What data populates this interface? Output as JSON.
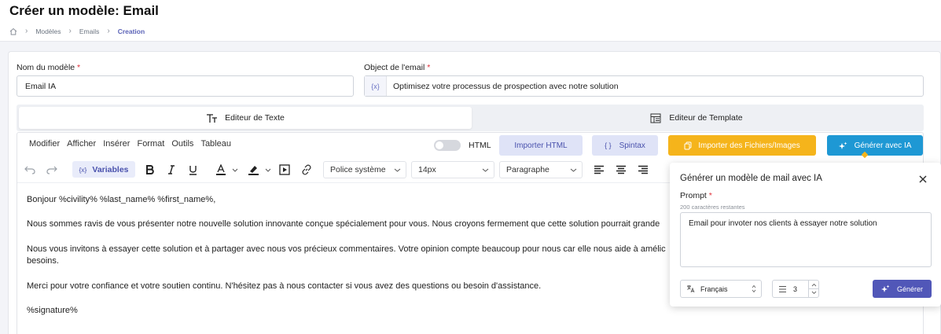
{
  "page": {
    "title": "Créer un modèle: Email",
    "breadcrumb": [
      "Modèles",
      "Emails",
      "Creation"
    ]
  },
  "form": {
    "name_label": "Nom du modèle",
    "name_required": "*",
    "name_value": "Email IA",
    "object_label": "Object de l'email",
    "object_required": "*",
    "object_prefix": "{x}",
    "object_value": "Optimisez votre processus de prospection avec notre solution"
  },
  "tabs": [
    {
      "label": "Editeur de Texte",
      "active": true
    },
    {
      "label": "Editeur de Template",
      "active": false
    }
  ],
  "editor": {
    "menu": [
      "Modifier",
      "Afficher",
      "Insérer",
      "Format",
      "Outils",
      "Tableau"
    ],
    "html_toggle_label": "HTML",
    "buttons": {
      "import_html": "Importer HTML",
      "spintax": "Spintax",
      "spintax_prefix": "{ }",
      "import_files": "Importer des Fichiers/Images",
      "generate_ai": "Générer avec IA"
    },
    "toolbar": {
      "variables_prefix": "{x}",
      "variables": "Variables",
      "font_family": "Police système",
      "font_size": "14px",
      "block_format": "Paragraphe"
    },
    "content": [
      "Bonjour %civility% %last_name% %first_name%,",
      "Nous sommes ravis de vous présenter notre nouvelle solution innovante conçue spécialement pour vous. Nous croyons fermement que cette solution pourrait grande",
      "Nous vous invitons à essayer cette solution et à partager avec nous vos précieux commentaires. Votre opinion compte beaucoup pour nous car elle nous aide à amélic",
      "besoins.",
      "Merci pour votre confiance et votre soutien continu. N'hésitez pas à nous contacter si vous avez des questions ou besoin d'assistance.",
      "%signature%"
    ]
  },
  "ai_popup": {
    "title": "Générer un modèle de mail avec IA",
    "prompt_label": "Prompt",
    "prompt_required": "*",
    "remaining": "200 caractères restantes",
    "prompt_value": "Email pour invoter nos clients à essayer notre solution",
    "language": "Français",
    "count": "3",
    "generate": "Générer"
  },
  "colors": {
    "accent": "#5b63b7",
    "import_html_bg": "#dfe3f7",
    "spintax_bg": "#dfe3f7",
    "import_files_bg": "#f5b41b",
    "generate_ai_bg": "#1e98d4",
    "generate_bg": "#5157b8",
    "required": "#e0313b"
  }
}
